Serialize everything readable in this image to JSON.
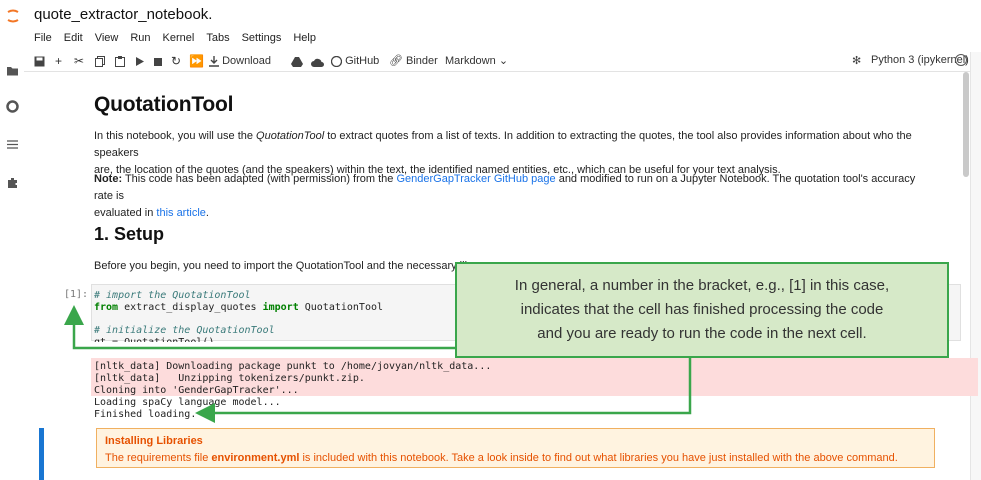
{
  "window": {
    "title": "quote_extractor_notebook."
  },
  "menubar": [
    "File",
    "Edit",
    "View",
    "Run",
    "Kernel",
    "Tabs",
    "Settings",
    "Help"
  ],
  "toolbar": {
    "download_label": "Download",
    "github_label": "GitHub",
    "binder_label": "Binder",
    "cell_type": "Markdown",
    "kernel_name": "Python 3 (ipykernel)"
  },
  "notebook": {
    "heading": "QuotationTool",
    "intro_1a": "In this notebook, you will use the ",
    "intro_1b": "QuotationTool",
    "intro_1c": " to extract quotes from a list of texts. In addition to extracting the quotes, the tool also provides information about who the speakers",
    "intro_2": "are, the location of the quotes (and the speakers) within the text, the identified named entities, etc., which can be useful for your text analysis.",
    "note_label": "Note:",
    "note_a": " This code has been adapted (with permission) from the ",
    "note_link": "GenderGapTracker GitHub page",
    "note_b": " and modified to run on a Jupyter Notebook. The quotation tool's accuracy rate is",
    "note_2a": "evaluated in ",
    "note_2_link": "this article",
    "note_2b": ".",
    "section_heading": "1. Setup",
    "setup_text": "Before you begin, you need to import the QuotationTool and the necessary libr",
    "cell_prompt": "[1]:",
    "code": {
      "l1": "# import the QuotationTool",
      "l2_from": "from",
      "l2_mod": " extract_display_quotes ",
      "l2_import": "import",
      "l2_name": " QuotationTool",
      "l3": "# initialize the QuotationTool",
      "l4": "qt = QuotationTool()"
    },
    "output": {
      "l1": "[nltk_data] Downloading package punkt to /home/jovyan/nltk_data...",
      "l2": "[nltk_data]   Unzipping tokenizers/punkt.zip.",
      "l3": "Cloning into 'GenderGapTracker'...",
      "l4": "Loading spaCy language model...",
      "l5": "Finished loading."
    },
    "install_box": {
      "title": "Installing Libraries",
      "text_a": "The requirements file ",
      "text_bold": "environment.yml",
      "text_b": " is included with this notebook. Take a look inside to find out what libraries you have just installed with the above command."
    }
  },
  "callout": {
    "line1": "In general, a number in the bracket, e.g., [1] in this case,",
    "line2": "indicates that the cell has finished processing the code",
    "line3": "and you are ready to run the code in the next cell."
  },
  "colors": {
    "accent_green": "#3aa64b",
    "callout_fill": "#d6e9c8",
    "link_blue": "#1a73e8",
    "error_output": "#fddcdc",
    "warning_text": "#e65100",
    "active_cell_bar": "#1976d2"
  }
}
